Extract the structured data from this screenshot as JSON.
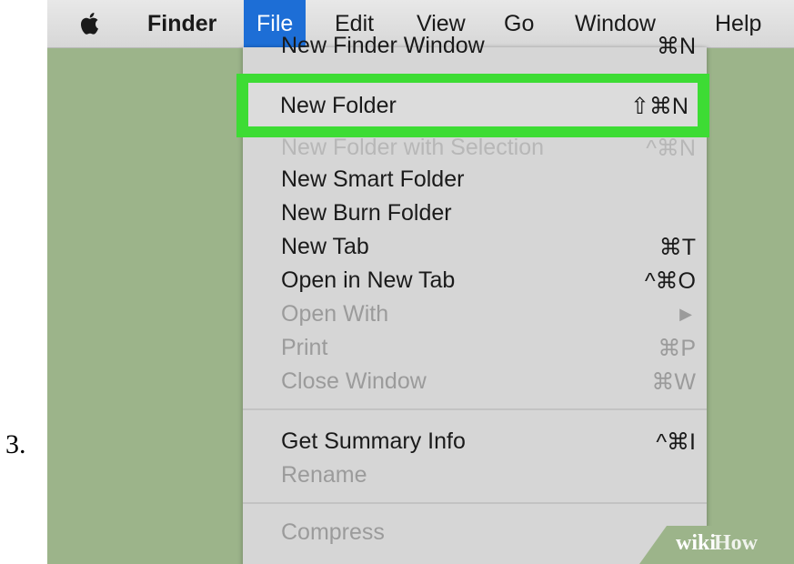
{
  "step_number": "3.",
  "menubar": {
    "apple_icon": "apple-icon",
    "items": [
      "Finder",
      "File",
      "Edit",
      "View",
      "Go",
      "Window",
      "Help"
    ]
  },
  "file_menu": {
    "items": [
      {
        "label": "New Finder Window",
        "shortcut": "⌘N"
      },
      {
        "label": "New Folder",
        "shortcut": "⇧⌘N"
      },
      {
        "label": "New Folder with Selection",
        "shortcut": "^⌘N"
      },
      {
        "label": "New Smart Folder",
        "shortcut": ""
      },
      {
        "label": "New Burn Folder",
        "shortcut": ""
      },
      {
        "label": "New Tab",
        "shortcut": "⌘T"
      },
      {
        "label": "Open in New Tab",
        "shortcut": "^⌘O"
      },
      {
        "label": "Open With",
        "shortcut": "▶"
      },
      {
        "label": "Print",
        "shortcut": "⌘P"
      },
      {
        "label": "Close Window",
        "shortcut": "⌘W"
      },
      {
        "label": "Get Summary Info",
        "shortcut": "^⌘I"
      },
      {
        "label": "Rename",
        "shortcut": ""
      },
      {
        "label": "Compress",
        "shortcut": ""
      }
    ]
  },
  "watermark": {
    "part1": "wiki",
    "part2": "How"
  },
  "colors": {
    "selected_menu": "#1d6ed6",
    "highlight": "#3ddc34",
    "desktop": "#9cb48a"
  }
}
